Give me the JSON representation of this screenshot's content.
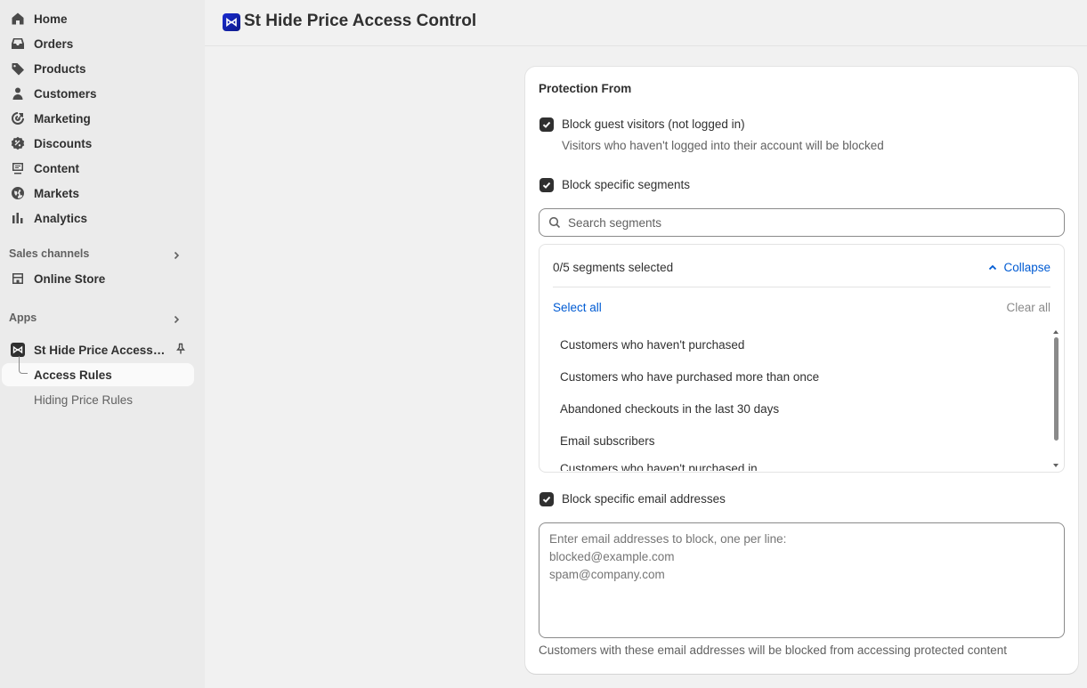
{
  "sidebar": {
    "nav": [
      {
        "label": "Home",
        "icon": "home-icon"
      },
      {
        "label": "Orders",
        "icon": "inbox-icon"
      },
      {
        "label": "Products",
        "icon": "tag-icon"
      },
      {
        "label": "Customers",
        "icon": "person-icon"
      },
      {
        "label": "Marketing",
        "icon": "target-icon"
      },
      {
        "label": "Discounts",
        "icon": "discount-icon"
      },
      {
        "label": "Content",
        "icon": "content-icon"
      },
      {
        "label": "Markets",
        "icon": "globe-icon"
      },
      {
        "label": "Analytics",
        "icon": "bar-chart-icon"
      }
    ],
    "sales_channels_title": "Sales channels",
    "online_store_label": "Online Store",
    "apps_title": "Apps",
    "app_label": "St Hide Price Access ...",
    "sub_items": [
      {
        "label": "Access Rules",
        "active": true
      },
      {
        "label": "Hiding Price Rules",
        "active": false
      }
    ]
  },
  "header": {
    "title": "St Hide Price Access Control"
  },
  "card": {
    "title": "Protection From",
    "guest": {
      "label": "Block guest visitors (not logged in)",
      "help": "Visitors who haven't logged into their account will be blocked",
      "checked": true
    },
    "segments": {
      "label": "Block specific segments",
      "checked": true,
      "search_placeholder": "Search segments",
      "count_text": "0/5 segments selected",
      "collapse_label": "Collapse",
      "select_all_label": "Select all",
      "clear_all_label": "Clear all",
      "items": [
        "Customers who haven't purchased",
        "Customers who have purchased more than once",
        "Abandoned checkouts in the last 30 days",
        "Email subscribers",
        "Customers who haven't purchased in"
      ]
    },
    "emails": {
      "label": "Block specific email addresses",
      "checked": true,
      "placeholder": "Enter email addresses to block, one per line:\nblocked@example.com\nspam@company.com",
      "help": "Customers with these email addresses will be blocked from accessing protected content"
    }
  },
  "colors": {
    "link": "#005bd3",
    "checkbox": "#303030",
    "sidebar_bg": "#ebebeb",
    "page_bg": "#f1f1f1"
  }
}
